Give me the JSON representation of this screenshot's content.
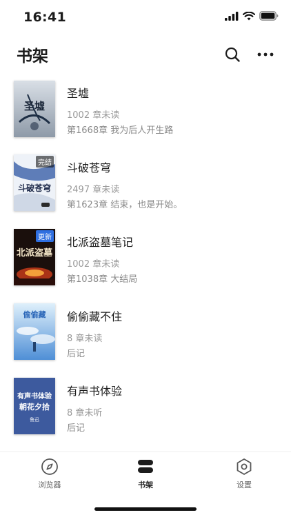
{
  "status_bar": {
    "time": "16:41"
  },
  "header": {
    "title": "书架",
    "search_icon": "search-icon",
    "more_icon": "more-icon"
  },
  "books": [
    {
      "title": "圣墟",
      "unread": "1002 章未读",
      "latest": "第1668章 我为后人开生路",
      "badge": "",
      "cover_text": "圣墟"
    },
    {
      "title": "斗破苍穹",
      "unread": "2497 章未读",
      "latest": "第1623章 结束，也是开始。",
      "badge": "完结",
      "cover_text": "斗破苍穹"
    },
    {
      "title": "北派盗墓笔记",
      "unread": "1002 章未读",
      "latest": "第1038章 大结局",
      "badge": "更新",
      "cover_text": "北派盗墓"
    },
    {
      "title": "偷偷藏不住",
      "unread": "8 章未读",
      "latest": "后记",
      "badge": "",
      "cover_text": "偷偷藏"
    },
    {
      "title": "有声书体验",
      "unread": "8 章未听",
      "latest": "后记",
      "badge": "",
      "cover_text": "有声书体验",
      "cover_subtext": "朝花夕拾",
      "cover_author": "鲁迅"
    }
  ],
  "tabs": [
    {
      "label": "浏览器",
      "icon": "compass-icon"
    },
    {
      "label": "书架",
      "icon": "bookshelf-icon"
    },
    {
      "label": "设置",
      "icon": "settings-icon"
    }
  ],
  "colors": {
    "accent": "#1c1c1c",
    "muted": "#9a9a9a",
    "badge_blue": "#2f6fe0"
  }
}
